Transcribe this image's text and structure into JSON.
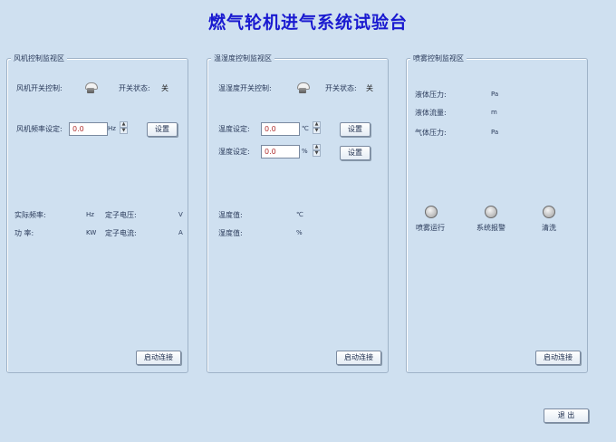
{
  "window_title": "燃气轮机进气系统试验台",
  "fan": {
    "title": "风机控制监视区",
    "switch_label": "风机开关控制:",
    "status_label": "开关状态:",
    "status_value": "关",
    "freq_label": "风机频率设定:",
    "freq_value": "0.0",
    "freq_unit": "Hz",
    "set_label": "设置",
    "actual_freq_label": "实际频率:",
    "actual_freq_unit": "Hz",
    "stator_voltage_label": "定子电压:",
    "stator_voltage_unit": "V",
    "power_label": "功  率:",
    "power_unit": "KW",
    "stator_current_label": "定子电流:",
    "stator_current_unit": "A",
    "connect_label": "启动连接"
  },
  "humidity": {
    "title": "温湿度控制监视区",
    "switch_label": "温湿度开关控制:",
    "status_label": "开关状态:",
    "status_value": "关",
    "temp_label": "温度设定:",
    "temp_value": "0.0",
    "temp_unit": "℃",
    "humid_label": "湿度设定:",
    "humid_value": "0.0",
    "humid_unit": "%",
    "set_label": "设置",
    "temp_read_label": "温度值:",
    "temp_read_unit": "℃",
    "humid_read_label": "湿度值:",
    "humid_read_unit": "%",
    "connect_label": "启动连接"
  },
  "spray": {
    "title": "喷雾控制监视区",
    "liquid_pressure_label": "液体压力:",
    "liquid_pressure_unit": "Pa",
    "liquid_flow_label": "液体流量:",
    "liquid_flow_unit": "m",
    "gas_pressure_label": "气体压力:",
    "gas_pressure_unit": "Pa",
    "indicator_run": "喷雾运行",
    "indicator_alarm": "系统报警",
    "indicator_clean": "清洗",
    "connect_label": "启动连接"
  },
  "exit_label": "退  出"
}
